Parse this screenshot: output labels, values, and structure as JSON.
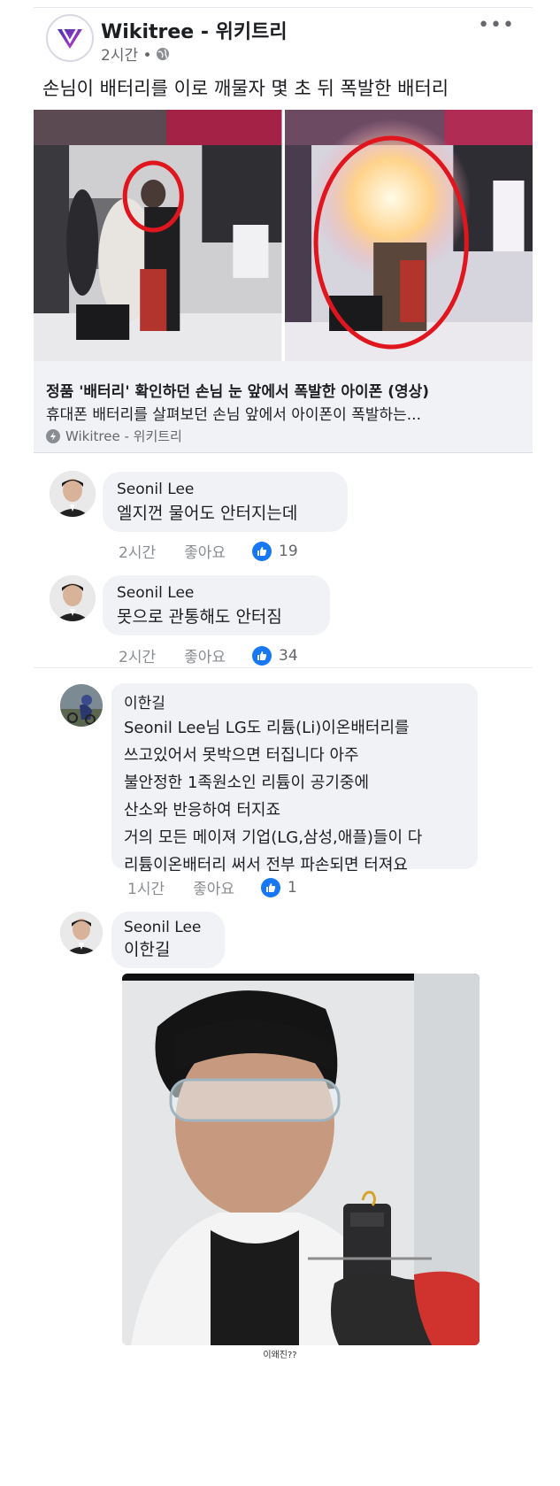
{
  "post": {
    "page_name": "Wikitree - 위키트리",
    "time": "2시간 •",
    "text": "손님이 배터리를 이로 깨물자 몇 초 뒤 폭발한 배터리",
    "more_label": "•••"
  },
  "link": {
    "title": "정품 '배터리' 확인하던 손님 눈 앞에서 폭발한 아이폰 (영상)",
    "description": "휴대폰 배터리를 살펴보던 손님 앞에서 아이폰이 폭발하는...",
    "source": "Wikitree - 위키트리"
  },
  "comments": [
    {
      "author": "Seonil Lee",
      "text": "엘지껀 물어도 안터지는데",
      "time": "2시간",
      "like_label": "좋아요",
      "likes": "19"
    },
    {
      "author": "Seonil Lee",
      "text": "못으로 관통해도 안터짐",
      "time": "2시간",
      "like_label": "좋아요",
      "likes": "34"
    }
  ],
  "replies": [
    {
      "author": "이한길",
      "text": "Seonil Lee님 LG도 리튬(Li)이온배터리를\n쓰고있어서 못박으면 터집니다 아주\n불안정한 1족원소인 리튬이 공기중에\n산소와 반응하여 터지죠\n거의 모든 메이져 기업(LG,삼성,애플)들이 다\n리튬이온배터리 써서 전부 파손되면 터져요",
      "time": "1시간",
      "like_label": "좋아요",
      "likes": "1"
    },
    {
      "author": "Seonil Lee",
      "text": "이한길"
    }
  ],
  "caption": "이왜진??",
  "colors": {
    "like_blue": "#1877f2",
    "bubble_bg": "#f0f2f5",
    "circle_red": "#e0161e"
  }
}
